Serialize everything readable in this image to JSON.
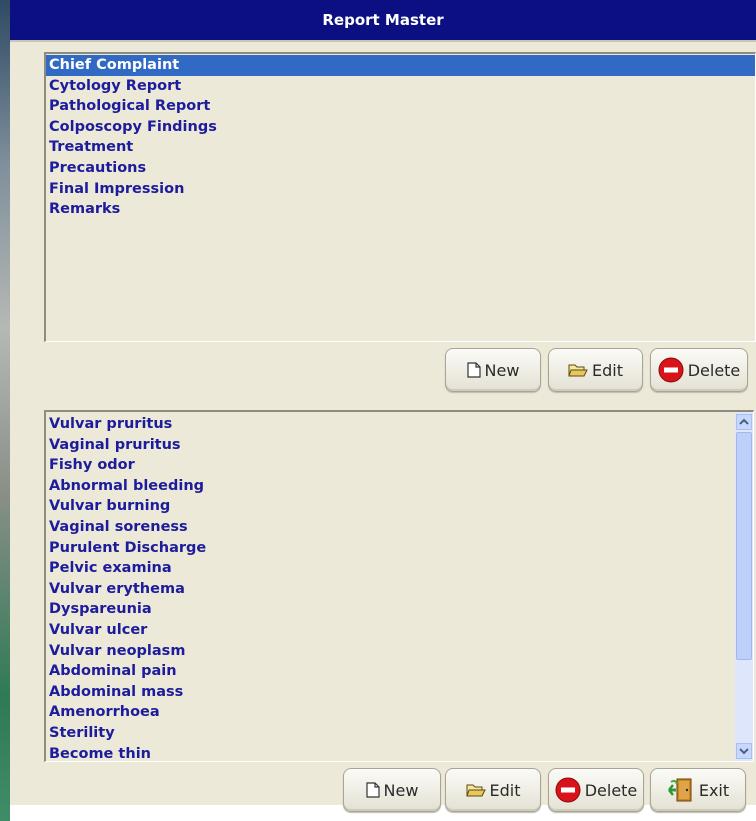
{
  "window": {
    "title": "Report Master"
  },
  "report_types": {
    "selected_index": 0,
    "items": [
      "Chief Complaint",
      "Cytology Report",
      "Pathological Report",
      "Colposcopy Findings",
      "Treatment",
      "Precautions",
      "Final Impression",
      "Remarks"
    ]
  },
  "top_toolbar": {
    "new_label": "New",
    "edit_label": "Edit",
    "delete_label": "Delete"
  },
  "complaints": {
    "items": [
      "Vulvar pruritus",
      "Vaginal pruritus",
      "Fishy odor",
      "Abnormal bleeding",
      "Vulvar burning",
      "Vaginal soreness",
      "Purulent Discharge",
      "Pelvic examina",
      "Vulvar erythema",
      "Dyspareunia",
      "Vulvar ulcer",
      "Vulvar neoplasm",
      "Abdominal pain",
      "Abdominal mass",
      "Amenorrhoea",
      "Sterility",
      "Become thin"
    ]
  },
  "bottom_toolbar": {
    "new_label": "New",
    "edit_label": "Edit",
    "delete_label": "Delete",
    "exit_label": "Exit"
  },
  "colors": {
    "title_bar": "#0b0f82",
    "selection": "#316ac5",
    "item_text": "#1c1c9c",
    "window_bg": "#ece9d8"
  }
}
